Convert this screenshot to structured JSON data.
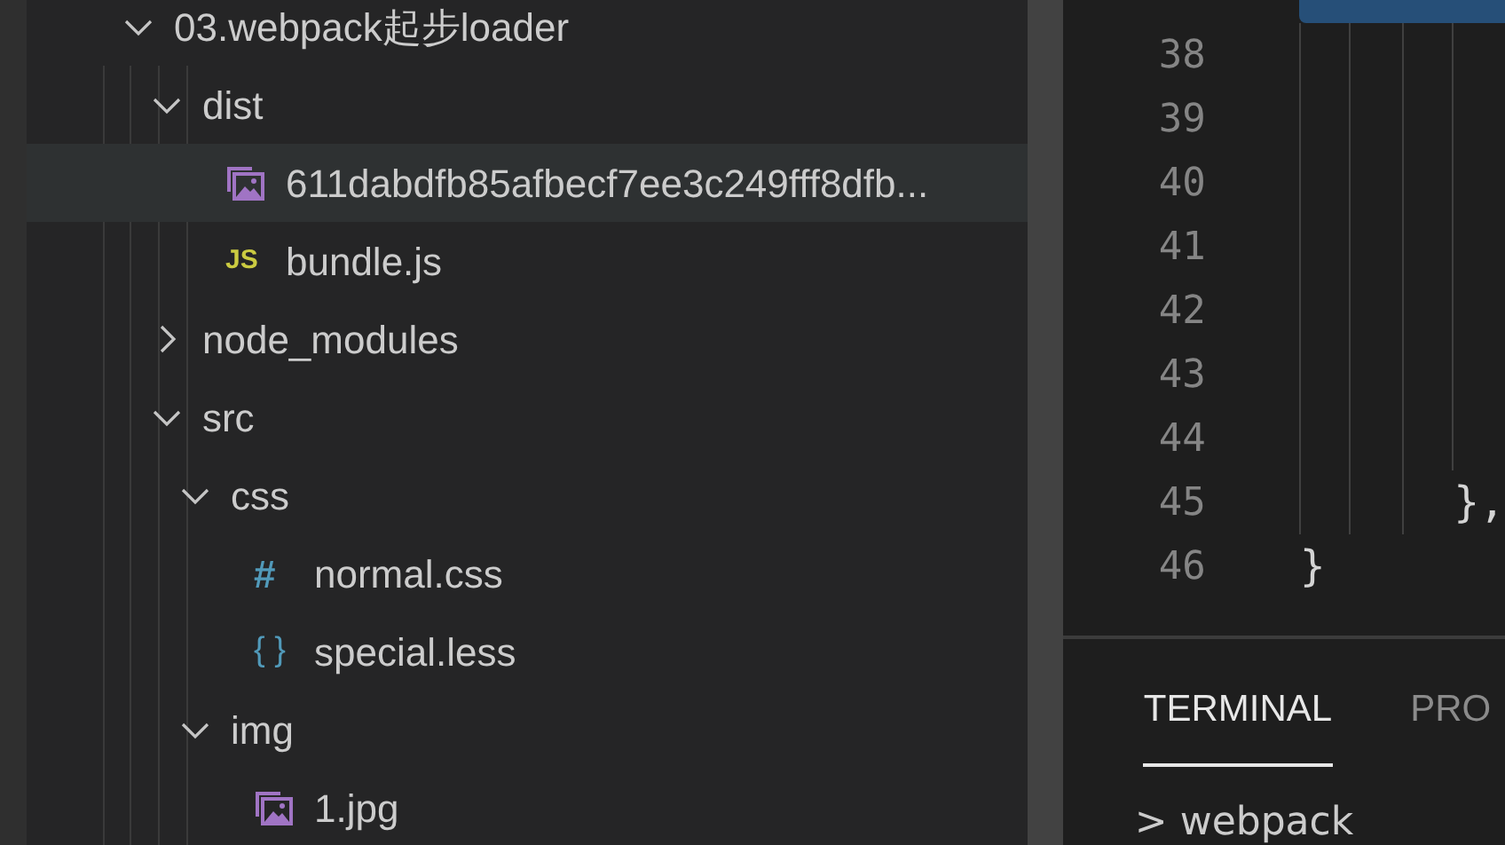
{
  "explorer": {
    "tree": [
      {
        "label": "03.webpack起步loader",
        "kind": "folder",
        "expanded": true,
        "selected": false,
        "children": [
          {
            "label": "dist",
            "kind": "folder",
            "expanded": true,
            "selected": false,
            "children": [
              {
                "label": "611dabdfb85afbecf7ee3c249fff8dfb...",
                "kind": "image",
                "selected": true
              },
              {
                "label": "bundle.js",
                "kind": "js",
                "icon": "JS",
                "selected": false
              }
            ]
          },
          {
            "label": "node_modules",
            "kind": "folder",
            "expanded": false,
            "selected": false
          },
          {
            "label": "src",
            "kind": "folder",
            "expanded": true,
            "selected": false,
            "children": [
              {
                "label": "css",
                "kind": "folder",
                "expanded": true,
                "selected": false,
                "children": [
                  {
                    "label": "normal.css",
                    "kind": "css",
                    "icon": "#",
                    "selected": false
                  },
                  {
                    "label": "special.less",
                    "kind": "less",
                    "icon": "{ }",
                    "selected": false
                  }
                ]
              },
              {
                "label": "img",
                "kind": "folder",
                "expanded": true,
                "selected": false,
                "children": [
                  {
                    "label": "1.jpg",
                    "kind": "image",
                    "selected": false
                  }
                ]
              }
            ]
          }
        ]
      }
    ]
  },
  "editor": {
    "lines": [
      {
        "number": "38"
      },
      {
        "number": "39"
      },
      {
        "number": "40"
      },
      {
        "number": "41"
      },
      {
        "number": "42"
      },
      {
        "number": "43"
      },
      {
        "number": "44"
      },
      {
        "number": "45",
        "code": "      },"
      },
      {
        "number": "46",
        "code": "}"
      }
    ]
  },
  "panel": {
    "tabs": [
      {
        "label": "TERMINAL",
        "selected": true
      },
      {
        "label": "PRO",
        "selected": false
      }
    ],
    "terminal_lines": [
      "> webpack"
    ]
  }
}
